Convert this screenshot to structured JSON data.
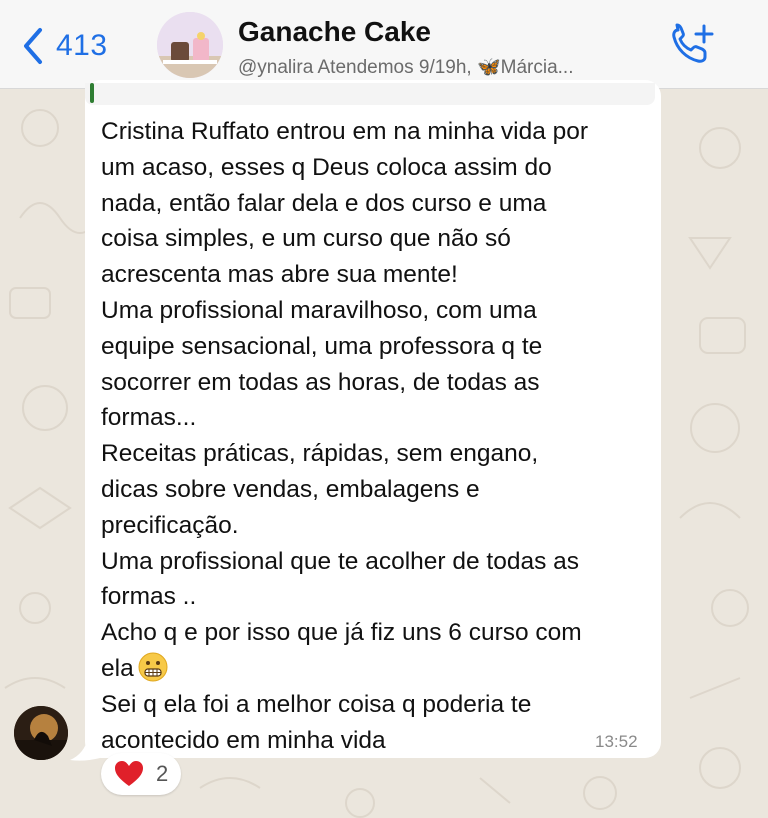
{
  "header": {
    "back_count": "413",
    "title": "Ganache Cake",
    "subtitle": "@ynalira Atendemos 9/19h, 🦋Márcia..."
  },
  "message": {
    "lines": [
      "Cristina Ruffato entrou em na minha vida por",
      "um acaso, esses q Deus coloca assim do",
      "nada, então falar dela e dos curso e uma",
      "coisa simples, e um curso que não só",
      "acrescenta mas abre sua mente!",
      "Uma profissional maravilhoso, com uma",
      "equipe sensacional, uma professora q te",
      "socorrer em todas as horas, de todas as",
      "formas...",
      "Receitas práticas, rápidas, sem engano,",
      "dicas sobre vendas, embalagens e",
      "precificação.",
      "Uma profissional que te acolher de todas as",
      "formas ..",
      "Acho q e por isso que já fiz uns 6 curso com",
      "ela",
      "Sei q ela foi a melhor coisa q poderia te",
      "acontecido em minha vida"
    ],
    "time": "13:52"
  },
  "reaction": {
    "emoji": "heart-icon",
    "count": "2"
  },
  "colors": {
    "accent": "#1f6fe5",
    "wallpaper": "#ebe6dd",
    "bubble": "#ffffff",
    "reply_bar": "#2e7d32"
  }
}
